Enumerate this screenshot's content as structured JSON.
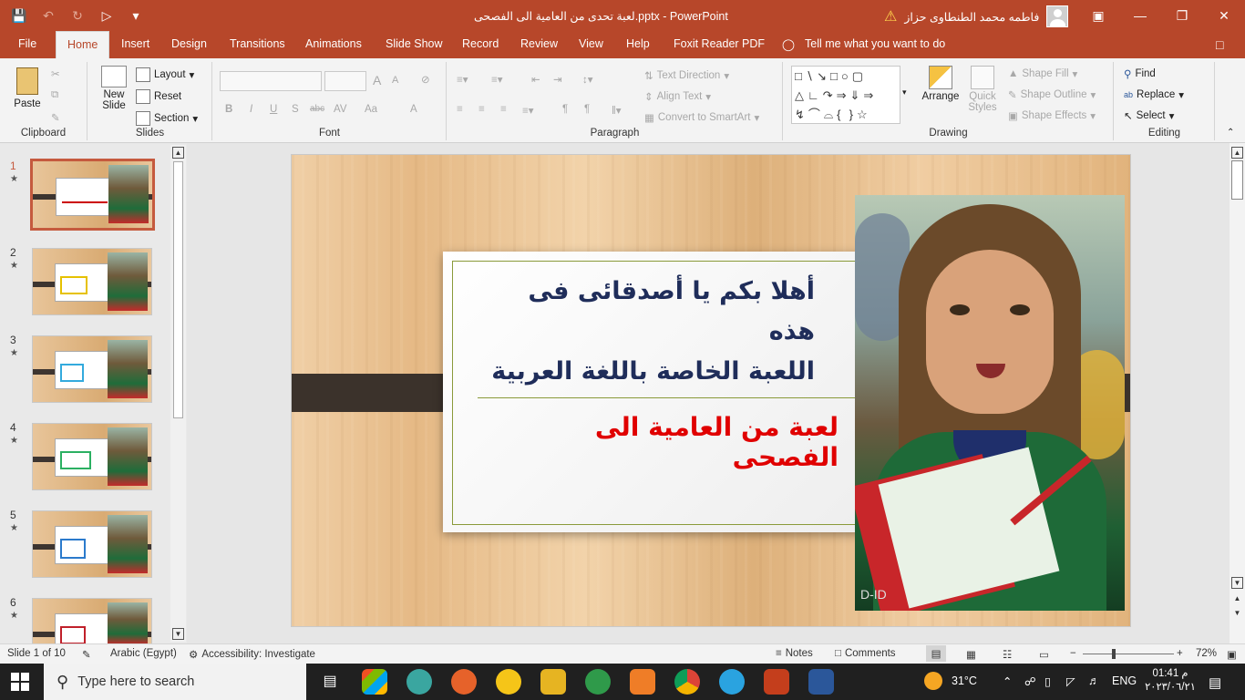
{
  "window": {
    "title": "لعبة تحدى من العامية الى الفصحى.pptx  -  PowerPoint",
    "user": "فاطمه محمد الطنطاوى حزاز"
  },
  "tabs": [
    "File",
    "Home",
    "Insert",
    "Design",
    "Transitions",
    "Animations",
    "Slide Show",
    "Record",
    "Review",
    "View",
    "Help",
    "Foxit Reader PDF"
  ],
  "tell_me": "Tell me what you want to do",
  "ribbon": {
    "clipboard": {
      "paste": "Paste",
      "label": "Clipboard"
    },
    "slides": {
      "new_slide_1": "New",
      "new_slide_2": "Slide",
      "layout": "Layout",
      "reset": "Reset",
      "section": "Section",
      "label": "Slides"
    },
    "font": {
      "label": "Font",
      "bold": "B",
      "italic": "I",
      "underline": "U",
      "shadow": "S",
      "strike": "abc",
      "spacing": "AV",
      "case": "Aa",
      "color": "A",
      "grow": "A",
      "shrink": "A"
    },
    "paragraph": {
      "label": "Paragraph",
      "text_direction": "Text Direction",
      "align_text": "Align Text",
      "convert_smartart": "Convert to SmartArt"
    },
    "drawing": {
      "label": "Drawing",
      "arrange": "Arrange",
      "quick_styles_1": "Quick",
      "quick_styles_2": "Styles",
      "shape_fill": "Shape Fill",
      "shape_outline": "Shape Outline",
      "shape_effects": "Shape Effects"
    },
    "editing": {
      "label": "Editing",
      "find": "Find",
      "replace": "Replace",
      "select": "Select"
    }
  },
  "thumbnails": [
    {
      "num": "1",
      "selected": true
    },
    {
      "num": "2",
      "selected": false
    },
    {
      "num": "3",
      "selected": false
    },
    {
      "num": "4",
      "selected": false
    },
    {
      "num": "5",
      "selected": false
    },
    {
      "num": "6",
      "selected": false
    }
  ],
  "slide": {
    "title_line1": "أهلا بكم يا أصدقائى فى هذه",
    "title_line2": "اللعبة الخاصة باللغة العربية",
    "subtitle": "لعبة من العامية الى الفصحى",
    "watermark": "D-ID"
  },
  "status": {
    "slide_of": "Slide 1 of 10",
    "language": "Arabic (Egypt)",
    "accessibility": "Accessibility: Investigate",
    "notes": "Notes",
    "comments": "Comments",
    "zoom": "72%"
  },
  "taskbar": {
    "search_placeholder": "Type here to search",
    "temperature": "31°C",
    "input_lang": "ENG",
    "time": "01:41 م",
    "date": "٢٠٢٣/٠٦/٢١"
  },
  "colors": {
    "accent": "#b7472a",
    "title": "#1f2d5a",
    "subtitle": "#e00000"
  }
}
